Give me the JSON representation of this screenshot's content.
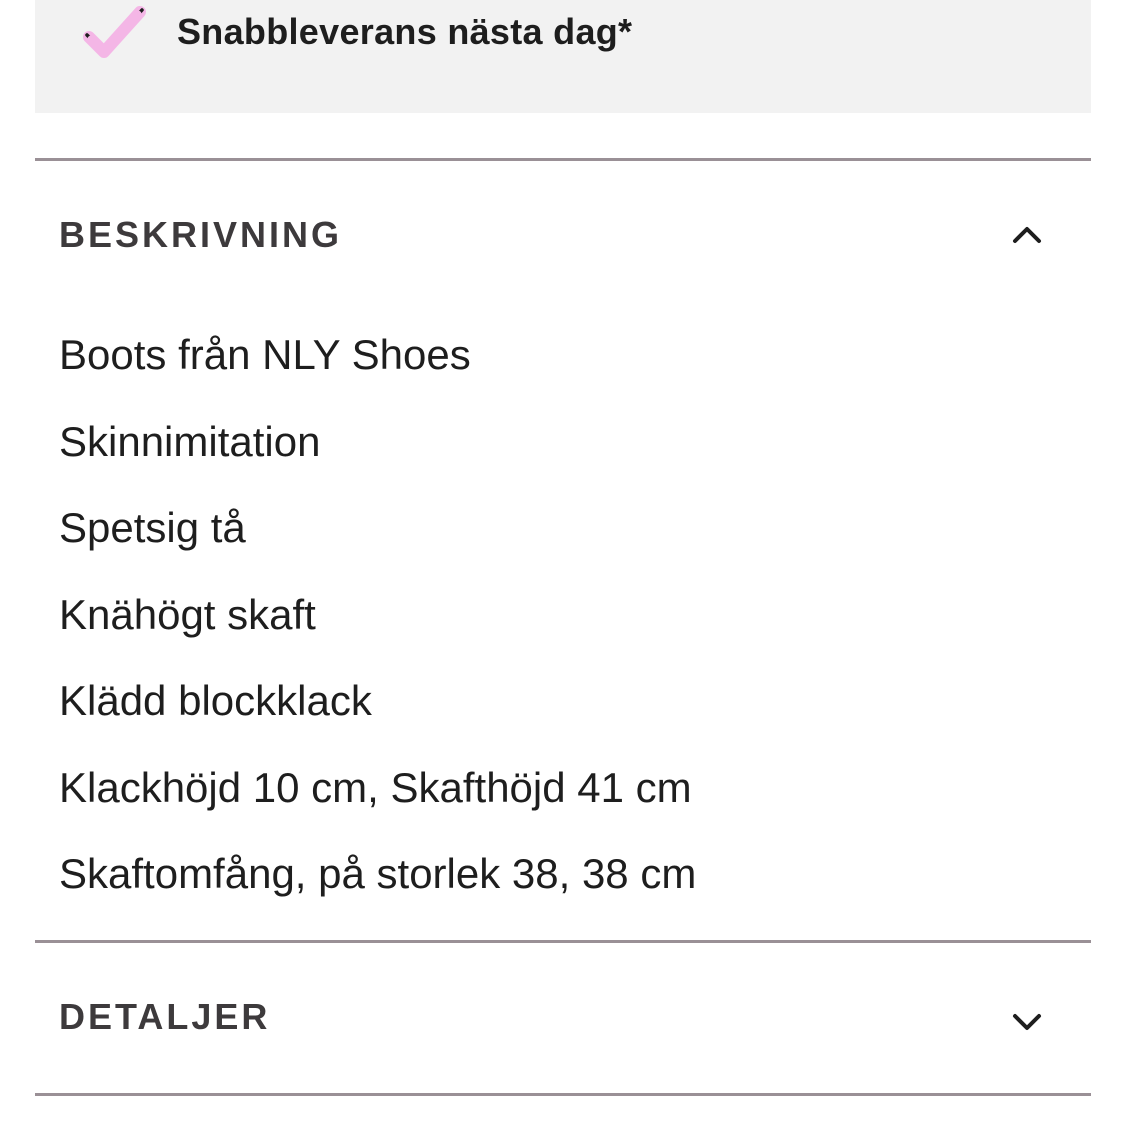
{
  "delivery": {
    "text": "Snabbleverans nästa dag*",
    "icon": "check-icon",
    "icon_color": "#f4b6e6"
  },
  "sections": [
    {
      "title": "BESKRIVNING",
      "expanded": true,
      "chevron": "chevron-up-icon",
      "items": [
        "Boots från NLY Shoes",
        "Skinnimitation",
        "Spetsig tå",
        "Knähögt skaft",
        "Klädd blockklack",
        "Klackhöjd 10 cm, Skafthöjd 41 cm",
        "Skaftomfång, på storlek 38, 38 cm"
      ]
    },
    {
      "title": "DETALJER",
      "expanded": false,
      "chevron": "chevron-down-icon"
    }
  ],
  "colors": {
    "panel_background": "#f2f2f2",
    "divider": "#9a9096",
    "heading": "#3d3a3c",
    "text": "#1e1e1e"
  }
}
